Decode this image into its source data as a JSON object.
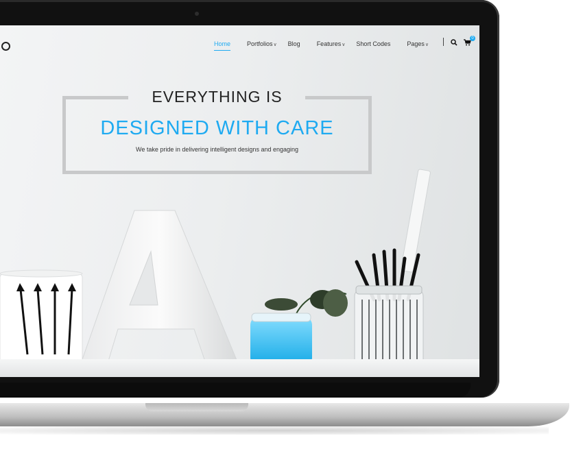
{
  "nav": {
    "items": [
      {
        "label": "Home",
        "active": true,
        "dropdown": false
      },
      {
        "label": "Portfolios",
        "active": false,
        "dropdown": true
      },
      {
        "label": "Blog",
        "active": false,
        "dropdown": false
      },
      {
        "label": "Features",
        "active": false,
        "dropdown": true
      },
      {
        "label": "Short Codes",
        "active": false,
        "dropdown": false
      },
      {
        "label": "Pages",
        "active": false,
        "dropdown": true
      }
    ],
    "search_icon": "search-icon",
    "cart_icon": "cart-icon",
    "cart_count": "0"
  },
  "hero": {
    "line1": "EVERYTHING IS",
    "line2": "DESIGNED WITH CARE",
    "subtitle": "We take pride in delivering intelligent designs and engaging"
  },
  "colors": {
    "accent": "#1eaaf1",
    "text_dark": "#222222",
    "frame": "#c8c9ca"
  }
}
